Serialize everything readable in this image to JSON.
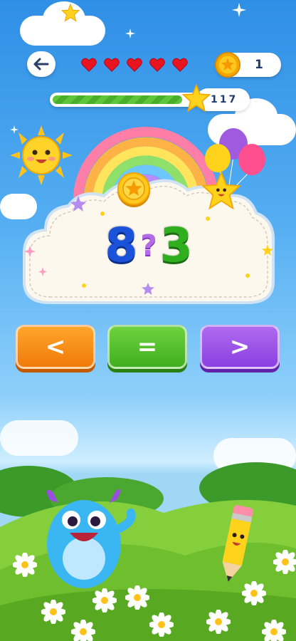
{
  "header": {
    "back_icon": "arrow-left-icon",
    "lives": 5,
    "coins": "1",
    "progress_fraction": 0.9,
    "score": "117"
  },
  "question": {
    "left_number": "8",
    "operator_placeholder": "?",
    "right_number": "3"
  },
  "answers": {
    "less_label": "<",
    "equal_label": "=",
    "greater_label": ">"
  },
  "colors": {
    "less": "#f07a0a",
    "equal": "#3fae20",
    "greater": "#8a3fe0",
    "heart": "#e8141f"
  }
}
